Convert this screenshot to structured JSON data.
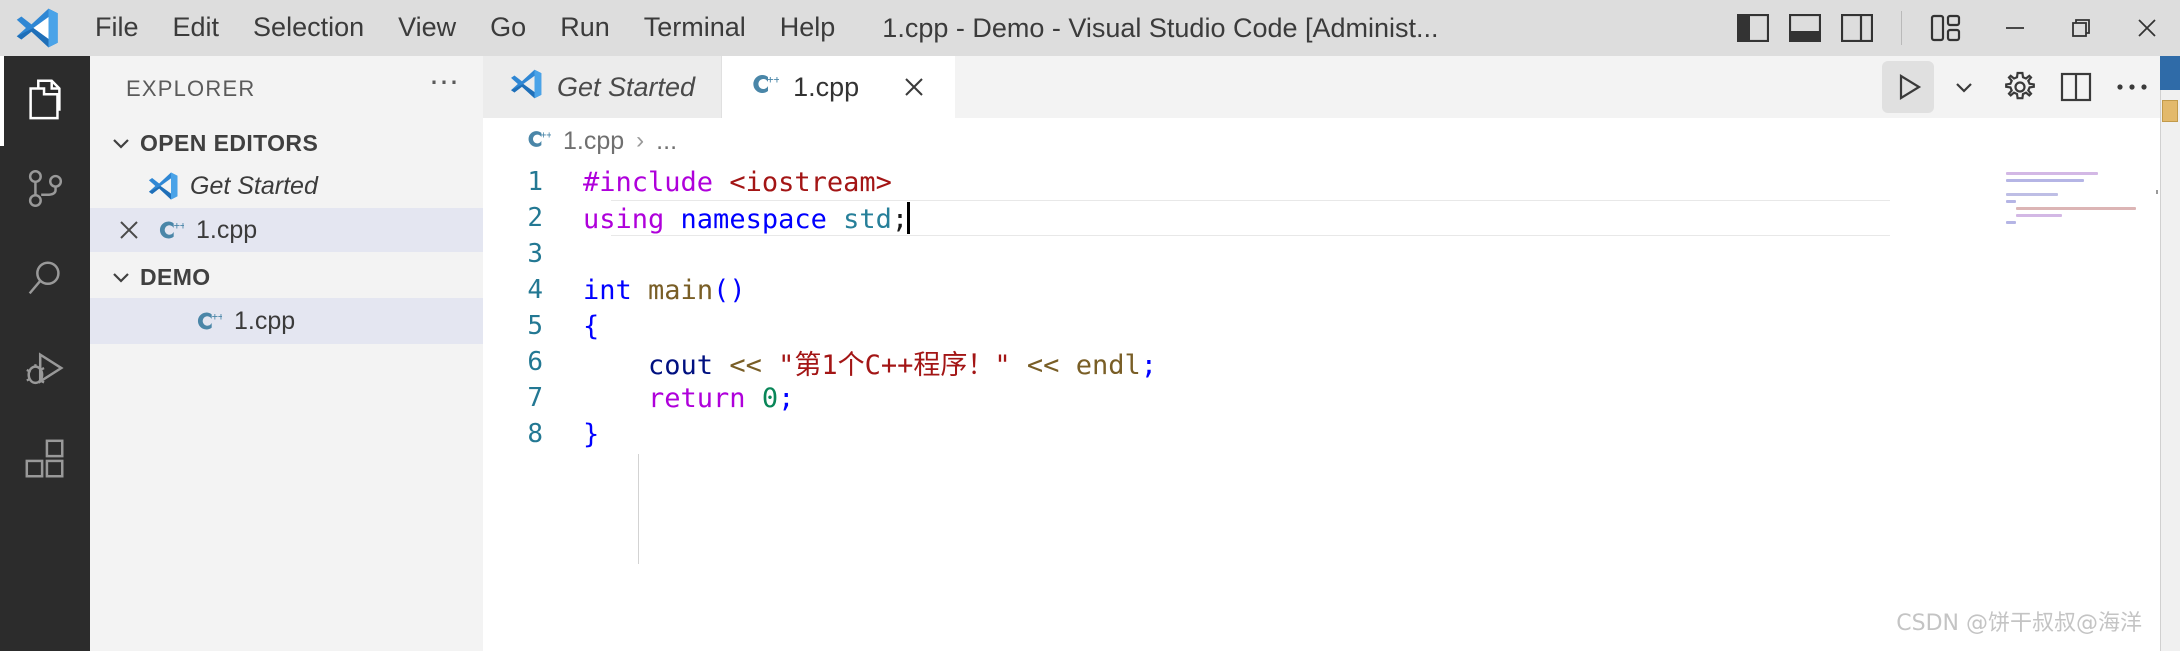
{
  "titlebar": {
    "logo_icon": "vscode-logo-icon",
    "menus": [
      "File",
      "Edit",
      "Selection",
      "View",
      "Go",
      "Run",
      "Terminal",
      "Help"
    ],
    "window_title": "1.cpp - Demo - Visual Studio Code [Administ...",
    "layout_controls": [
      {
        "name": "toggle-primary-sidebar-icon",
        "label": "Toggle Primary Side Bar"
      },
      {
        "name": "toggle-panel-icon",
        "label": "Toggle Panel"
      },
      {
        "name": "toggle-secondary-sidebar-icon",
        "label": "Toggle Secondary Side Bar"
      },
      {
        "name": "customize-layout-icon",
        "label": "Customize Layout"
      }
    ],
    "window_buttons": [
      {
        "name": "minimize-button",
        "glyph": "minimize-icon"
      },
      {
        "name": "maximize-button",
        "glyph": "restore-icon"
      },
      {
        "name": "close-button",
        "glyph": "close-icon"
      }
    ]
  },
  "activitybar": {
    "items": [
      {
        "name": "explorer",
        "icon": "files-icon",
        "active": true
      },
      {
        "name": "source-control",
        "icon": "source-control-icon",
        "active": false
      },
      {
        "name": "search",
        "icon": "search-icon",
        "active": false
      },
      {
        "name": "run-and-debug",
        "icon": "run-debug-icon",
        "active": false
      },
      {
        "name": "extensions",
        "icon": "extensions-icon",
        "active": false
      }
    ]
  },
  "sidebar": {
    "title": "EXPLORER",
    "actions_icon": "more-actions-icon",
    "sections": [
      {
        "label": "OPEN EDITORS",
        "expanded": true,
        "chevron": "chevron-down-icon",
        "items": [
          {
            "name": "Get Started",
            "icon": "vscode-logo-icon",
            "italic": true,
            "selected": false,
            "has_close": false
          },
          {
            "name": "1.cpp",
            "icon": "cpp-file-icon",
            "italic": false,
            "selected": true,
            "has_close": true,
            "close_icon": "close-icon"
          }
        ]
      },
      {
        "label": "DEMO",
        "expanded": true,
        "chevron": "chevron-down-icon",
        "items": [
          {
            "name": "1.cpp",
            "icon": "cpp-file-icon",
            "italic": false,
            "selected": true,
            "has_close": false
          }
        ]
      }
    ]
  },
  "editor": {
    "tabs": [
      {
        "label": "Get Started",
        "icon": "vscode-logo-icon",
        "active": false,
        "italic": true,
        "closable": false
      },
      {
        "label": "1.cpp",
        "icon": "cpp-file-icon",
        "active": true,
        "italic": false,
        "closable": true,
        "close_icon": "close-icon"
      }
    ],
    "actions": [
      {
        "name": "run-code-button",
        "icon": "play-icon",
        "highlighted": true
      },
      {
        "name": "run-options-button",
        "icon": "chevron-down-icon",
        "highlighted": false
      },
      {
        "name": "settings-button",
        "icon": "gear-icon",
        "highlighted": false
      },
      {
        "name": "split-editor-button",
        "icon": "split-editor-icon",
        "highlighted": false
      },
      {
        "name": "more-actions-button",
        "icon": "more-actions-icon",
        "highlighted": false
      }
    ],
    "breadcrumb": {
      "file_icon": "cpp-file-icon",
      "file": "1.cpp",
      "separator": "›",
      "more": "..."
    },
    "cursor_line": 2,
    "code": [
      {
        "n": "1",
        "tokens": [
          {
            "t": "#include ",
            "c": "t-keyword"
          },
          {
            "t": "<iostream>",
            "c": "t-string"
          }
        ]
      },
      {
        "n": "2",
        "tokens": [
          {
            "t": "using",
            "c": "t-keyword"
          },
          {
            "t": " ",
            "c": "t-plain"
          },
          {
            "t": "namespace",
            "c": "t-blue"
          },
          {
            "t": " ",
            "c": "t-plain"
          },
          {
            "t": "std",
            "c": "t-teal"
          },
          {
            "t": ";",
            "c": "t-plain"
          }
        ]
      },
      {
        "n": "3",
        "tokens": []
      },
      {
        "n": "4",
        "tokens": [
          {
            "t": "int",
            "c": "t-blue"
          },
          {
            "t": " ",
            "c": "t-plain"
          },
          {
            "t": "main",
            "c": "t-fn"
          },
          {
            "t": "()",
            "c": "t-blue"
          }
        ]
      },
      {
        "n": "5",
        "tokens": [
          {
            "t": "{",
            "c": "t-blue"
          }
        ]
      },
      {
        "n": "6",
        "tokens": [
          {
            "t": "    ",
            "c": "t-plain"
          },
          {
            "t": "cout",
            "c": "t-var"
          },
          {
            "t": " ",
            "c": "t-plain"
          },
          {
            "t": "<<",
            "c": "t-op"
          },
          {
            "t": " ",
            "c": "t-plain"
          },
          {
            "t": "\"第1个C++程序！\"",
            "c": "t-string"
          },
          {
            "t": " ",
            "c": "t-plain"
          },
          {
            "t": "<<",
            "c": "t-op"
          },
          {
            "t": " ",
            "c": "t-plain"
          },
          {
            "t": "endl",
            "c": "t-fn"
          },
          {
            "t": ";",
            "c": "t-blue"
          }
        ]
      },
      {
        "n": "7",
        "tokens": [
          {
            "t": "    ",
            "c": "t-plain"
          },
          {
            "t": "return",
            "c": "t-keyword"
          },
          {
            "t": " ",
            "c": "t-plain"
          },
          {
            "t": "0",
            "c": "t-num"
          },
          {
            "t": ";",
            "c": "t-blue"
          }
        ]
      },
      {
        "n": "8",
        "tokens": [
          {
            "t": "}",
            "c": "t-blue"
          }
        ]
      }
    ]
  },
  "watermark": "CSDN @饼干叔叔@海洋",
  "colors": {
    "titlebar_bg": "#dddddd",
    "activitybar_bg": "#2c2c2c",
    "sidebar_bg": "#f3f3f3",
    "editor_bg": "#ffffff",
    "selection_bg": "#e4e6f1",
    "line_number": "#237893",
    "accent_blue": "#2f87d4"
  }
}
